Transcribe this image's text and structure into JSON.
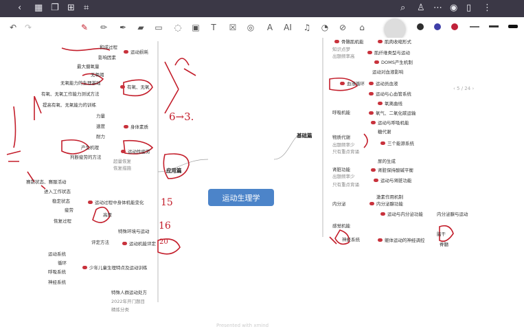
{
  "root_title": "运动生理学",
  "branches": {
    "left": "应用篇",
    "right": "基础篇"
  },
  "pager": "5 / 24",
  "footer": "Presented with xmind",
  "handwritten": {
    "a": "6→3.",
    "b": "15",
    "c": "16",
    "d": "20"
  },
  "icons": {
    "back": "chevron-left-icon",
    "grid": "grid-icon",
    "bookmark": "bookmark-icon",
    "add": "add-page-icon",
    "crop": "crop-icon",
    "search": "search-icon",
    "shirt": "shirt-icon",
    "eye": "eye-icon",
    "trash": "trash-icon",
    "more": "more-icon",
    "undo": "undo-icon",
    "redo": "redo-icon",
    "pen": "pen-icon",
    "pencil": "pencil-icon",
    "brush": "brush-icon",
    "highlighter": "highlighter-icon",
    "eraser": "eraser-icon",
    "lasso": "lasso-icon",
    "image": "image-icon",
    "text": "text-icon",
    "stamp": "stamp-icon",
    "ocr": "ocr-icon",
    "ai": "ai-icon",
    "mic": "mic-icon",
    "shape": "shape-icon",
    "link": "link-icon",
    "tag": "tag-icon"
  },
  "pen_colors": [
    "#2f2f2f",
    "#3f3fa8",
    "#c0223a"
  ],
  "left_nodes": [
    {
      "t": "和成过程",
      "g": false
    },
    {
      "t": "运动损耗",
      "g": false
    },
    {
      "t": "影响因素",
      "g": false
    },
    {
      "t": "最大摄氧量",
      "g": false
    },
    {
      "t": "无氧阈",
      "g": false
    },
    {
      "t": "无氧能力的生理基础",
      "g": false
    },
    {
      "t": "有氧、无氧",
      "g": false
    },
    {
      "t": "有氧、无氧工作能力测试方法",
      "g": false
    },
    {
      "t": "提高有氧、无氧能力的训练",
      "g": false
    },
    {
      "t": "力量",
      "g": false
    },
    {
      "t": "速度",
      "g": false
    },
    {
      "t": "身体素质",
      "g": false
    },
    {
      "t": "耐力",
      "g": false
    },
    {
      "t": "产生机理",
      "g": false
    },
    {
      "t": "运动性疲劳",
      "g": false
    },
    {
      "t": "判断疲劳的方法",
      "g": false
    },
    {
      "t": "超量恢复",
      "g": true
    },
    {
      "t": "恢复措施",
      "g": true
    },
    {
      "t": "赛前状态、赛服活动",
      "g": false
    },
    {
      "t": "进入工作状态",
      "g": false
    },
    {
      "t": "稳定状态",
      "g": false
    },
    {
      "t": "运动过程中身体机能变化",
      "g": false
    },
    {
      "t": "疲劳",
      "g": false
    },
    {
      "t": "恢复过程",
      "g": false
    },
    {
      "t": "高原",
      "g": false
    },
    {
      "t": "特殊环境与运动",
      "g": false
    },
    {
      "t": "评定方法",
      "g": false
    },
    {
      "t": "运动机能评定",
      "g": false
    },
    {
      "t": "运动系统",
      "g": false
    },
    {
      "t": "循环",
      "g": false
    },
    {
      "t": "呼吸系统",
      "g": false
    },
    {
      "t": "少年儿童生理特点及运动训练",
      "g": false
    },
    {
      "t": "神经系统",
      "g": false
    },
    {
      "t": "特殊人群运动处方",
      "g": false
    },
    {
      "t": "2022年开门题目",
      "g": true
    },
    {
      "t": "精炼分类",
      "g": true
    }
  ],
  "right_nodes": [
    {
      "t": "骨骼肌机能",
      "g": false
    },
    {
      "t": "肌肉收缩形式",
      "g": false
    },
    {
      "t": "知识点梦",
      "g": true
    },
    {
      "t": "肌纤维类型与运动",
      "g": false
    },
    {
      "t": "出题频率高",
      "g": true
    },
    {
      "t": "DOMS产生机制",
      "g": false
    },
    {
      "t": "运动对血液影响",
      "g": false
    },
    {
      "t": "血液循环",
      "g": false
    },
    {
      "t": "运动员血液",
      "g": false
    },
    {
      "t": "运动与心血管系统",
      "g": false
    },
    {
      "t": "氧离曲线",
      "g": false
    },
    {
      "t": "呼吸机能",
      "g": false
    },
    {
      "t": "氧气、二氧化碳运输",
      "g": false
    },
    {
      "t": "运动与呼吸机能",
      "g": false
    },
    {
      "t": "糖代谢",
      "g": false
    },
    {
      "t": "物质代谢",
      "g": false
    },
    {
      "t": "出题频率少",
      "g": true
    },
    {
      "t": "三个能源系统",
      "g": false
    },
    {
      "t": "只有重点背诵",
      "g": true
    },
    {
      "t": "尿的生成",
      "g": false
    },
    {
      "t": "肾脏功能",
      "g": false
    },
    {
      "t": "肾脏保持酸碱平衡",
      "g": false
    },
    {
      "t": "出题频率少",
      "g": true
    },
    {
      "t": "运动与肾脏功能",
      "g": false
    },
    {
      "t": "只有重点背诵",
      "g": true
    },
    {
      "t": "激素作用机制",
      "g": false
    },
    {
      "t": "内分泌",
      "g": false
    },
    {
      "t": "内分泌腺功能",
      "g": false
    },
    {
      "t": "运动与内分泌功能",
      "g": false
    },
    {
      "t": "内分泌腺与运动",
      "g": false
    },
    {
      "t": "感觉机能",
      "g": false
    },
    {
      "t": "神经系统",
      "g": false
    },
    {
      "t": "躯体运动的神经调控",
      "g": false
    },
    {
      "t": "脑干",
      "g": false
    },
    {
      "t": "脊髓",
      "g": false
    }
  ]
}
